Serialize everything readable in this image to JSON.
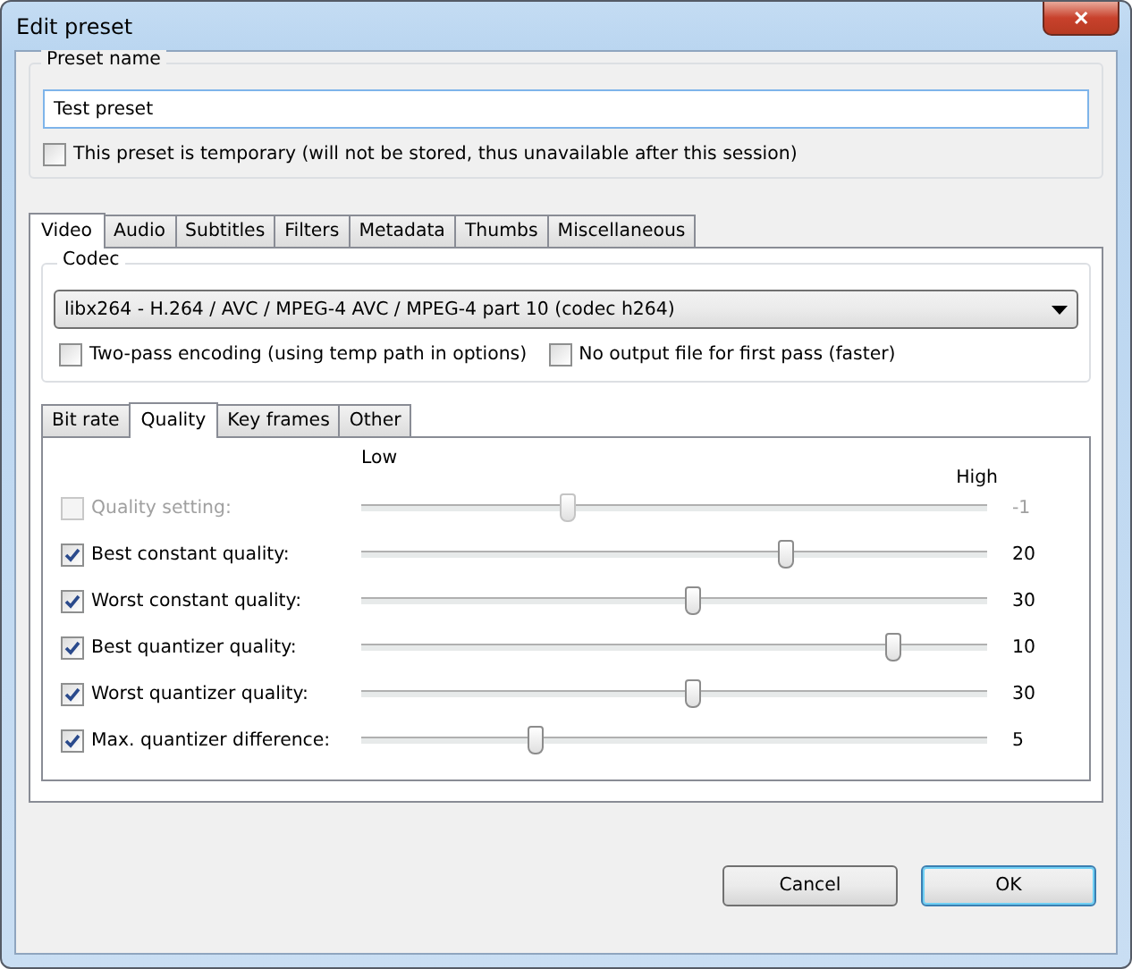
{
  "window": {
    "title": "Edit preset",
    "close": "✕"
  },
  "preset_name": {
    "label": "Preset name",
    "value": "Test preset"
  },
  "temporary": {
    "label": "This preset is temporary (will not be stored, thus unavailable after this session)",
    "checked": false
  },
  "tabs": [
    {
      "label": "Video",
      "selected": true
    },
    {
      "label": "Audio",
      "selected": false
    },
    {
      "label": "Subtitles",
      "selected": false
    },
    {
      "label": "Filters",
      "selected": false
    },
    {
      "label": "Metadata",
      "selected": false
    },
    {
      "label": "Thumbs",
      "selected": false
    },
    {
      "label": "Miscellaneous",
      "selected": false
    }
  ],
  "codec": {
    "label": "Codec",
    "value": "libx264 - H.264 / AVC / MPEG-4 AVC / MPEG-4 part 10 (codec h264)"
  },
  "options": [
    {
      "label": "Two-pass encoding (using temp path in options)",
      "checked": false
    },
    {
      "label": "No output file for first pass (faster)",
      "checked": false
    }
  ],
  "subtabs": [
    {
      "label": "Bit rate",
      "selected": false
    },
    {
      "label": "Quality",
      "selected": true
    },
    {
      "label": "Key frames",
      "selected": false
    },
    {
      "label": "Other",
      "selected": false
    }
  ],
  "scale": {
    "low": "Low",
    "high": "High"
  },
  "sliders": [
    {
      "label": "Quality setting:",
      "checked": false,
      "disabled": true,
      "level": 0.33,
      "reading": "-1"
    },
    {
      "label": "Best constant quality:",
      "checked": true,
      "disabled": false,
      "level": 0.68,
      "reading": "20"
    },
    {
      "label": "Worst constant quality:",
      "checked": true,
      "disabled": false,
      "level": 0.53,
      "reading": "30"
    },
    {
      "label": "Best quantizer quality:",
      "checked": true,
      "disabled": false,
      "level": 0.85,
      "reading": "10"
    },
    {
      "label": "Worst quantizer quality:",
      "checked": true,
      "disabled": false,
      "level": 0.53,
      "reading": "30"
    },
    {
      "label": "Max. quantizer difference:",
      "checked": true,
      "disabled": false,
      "level": 0.28,
      "reading": "5"
    }
  ],
  "buttons": [
    {
      "label": "Cancel",
      "default": false
    },
    {
      "label": "OK",
      "default": true
    }
  ]
}
